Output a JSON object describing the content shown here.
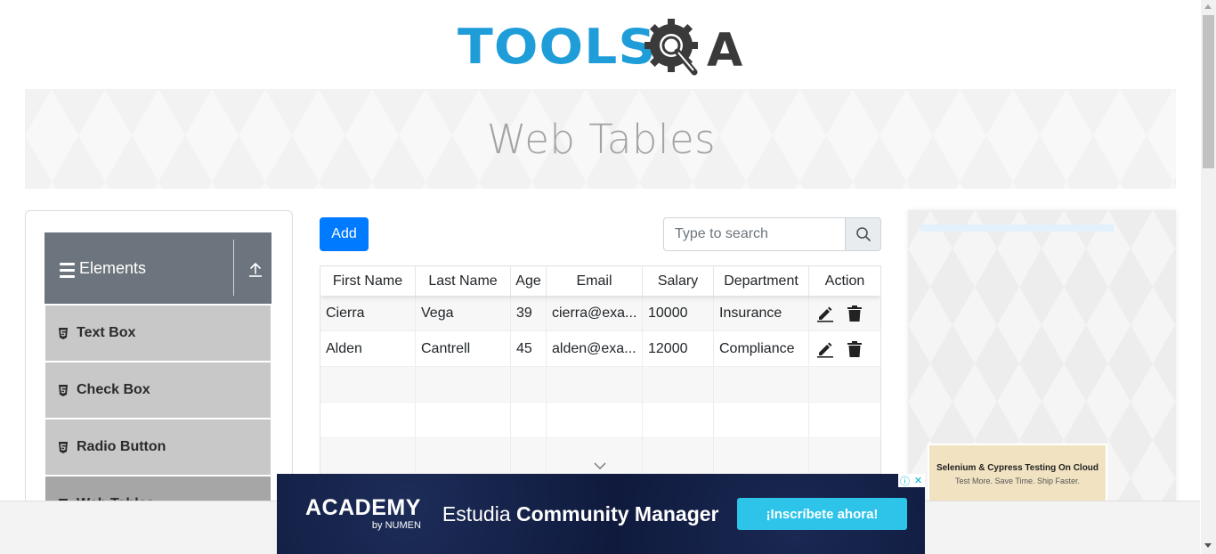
{
  "logo": {
    "part1": "TOOLS",
    "part2": "A",
    "colors": {
      "tools": "#1e9dd8",
      "qa": "#3a3a3a"
    }
  },
  "banner": {
    "title": "Web Tables"
  },
  "sidebar": {
    "group": {
      "title": "Elements",
      "icon": "hamburger-icon",
      "toggle_icon": "upload-icon"
    },
    "items": [
      {
        "label": "Text Box",
        "icon": "html5-icon"
      },
      {
        "label": "Check Box",
        "icon": "html5-icon"
      },
      {
        "label": "Radio Button",
        "icon": "html5-icon"
      },
      {
        "label": "Web Tables",
        "icon": "html5-icon"
      }
    ]
  },
  "toolbar": {
    "add_label": "Add"
  },
  "search": {
    "placeholder": "Type to search",
    "value": "",
    "icon": "search-icon"
  },
  "table": {
    "columns": [
      "First Name",
      "Last Name",
      "Age",
      "Email",
      "Salary",
      "Department",
      "Action"
    ],
    "rows": [
      {
        "first": "Cierra",
        "last": "Vega",
        "age": "39",
        "email": "cierra@exa...",
        "salary": "10000",
        "department": "Insurance"
      },
      {
        "first": "Alden",
        "last": "Cantrell",
        "age": "45",
        "email": "alden@exa...",
        "salary": "12000",
        "department": "Compliance"
      }
    ],
    "action_icons": [
      "edit-icon",
      "delete-icon"
    ]
  },
  "right_ad": {
    "title": "Selenium & Cypress Testing On Cloud",
    "subtitle": "Test More. Save Time. Ship Faster."
  },
  "bottom_ad": {
    "brand": "ACADEMY",
    "brand_sub": "by NUMEN",
    "headline_prefix": "Estudia",
    "headline_bold": "Community Manager",
    "cta": "¡Inscríbete ahora!",
    "colors": {
      "background": "#0f1a3d",
      "cta": "#2ec4ea"
    }
  },
  "colors": {
    "primary": "#007bff",
    "sidebar_header": "#6c757d",
    "sidebar_item": "#c8c8c8"
  }
}
